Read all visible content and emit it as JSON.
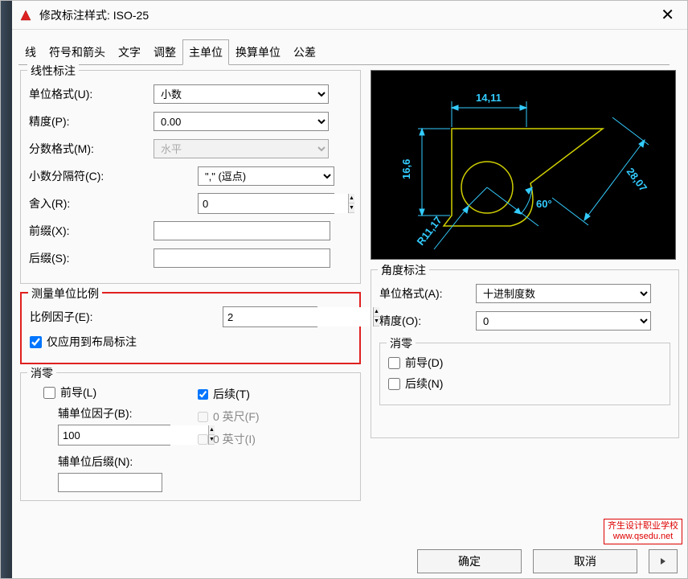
{
  "window": {
    "title": "修改标注样式: ISO-25"
  },
  "tabs": {
    "line": "线",
    "symbols": "符号和箭头",
    "text": "文字",
    "adjust": "调整",
    "primary": "主单位",
    "alternate": "换算单位",
    "tolerance": "公差"
  },
  "linear": {
    "group_title": "线性标注",
    "unit_format_label": "单位格式(U):",
    "unit_format_value": "小数",
    "precision_label": "精度(P):",
    "precision_value": "0.00",
    "fraction_label": "分数格式(M):",
    "fraction_value": "水平",
    "decimal_sep_label": "小数分隔符(C):",
    "decimal_sep_value": "\",\" (逗点)",
    "round_label": "舍入(R):",
    "round_value": "0",
    "prefix_label": "前缀(X):",
    "prefix_value": "",
    "suffix_label": "后缀(S):",
    "suffix_value": ""
  },
  "scale": {
    "group_title": "测量单位比例",
    "factor_label": "比例因子(E):",
    "factor_value": "2",
    "layout_only": "仅应用到布局标注"
  },
  "zero": {
    "group_title": "消零",
    "leading": "前导(L)",
    "trailing": "后续(T)",
    "sub_factor_label": "辅单位因子(B):",
    "sub_factor_value": "100",
    "sub_suffix_label": "辅单位后缀(N):",
    "sub_suffix_value": "",
    "feet": "0 英尺(F)",
    "inches": "0 英寸(I)"
  },
  "angular": {
    "group_title": "角度标注",
    "unit_format_label": "单位格式(A):",
    "unit_format_value": "十进制度数",
    "precision_label": "精度(O):",
    "precision_value": "0",
    "zero_title": "消零",
    "leading": "前导(D)",
    "trailing": "后续(N)"
  },
  "preview": {
    "dim1": "14,11",
    "dim2": "16,6",
    "dim3": "28,07",
    "dim4": "60°",
    "dim5": "R11,17"
  },
  "footer": {
    "ok": "确定",
    "cancel": "取消"
  },
  "watermark": {
    "line1": "齐生设计职业学校",
    "line2": "www.qsedu.net"
  }
}
